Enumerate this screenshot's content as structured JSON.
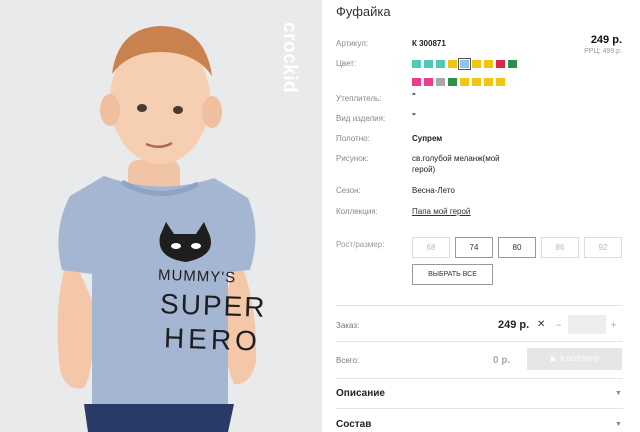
{
  "product": {
    "title": "Фуфайка",
    "price": "249 р.",
    "rrc": "РРЦ: 499 р.",
    "image": {
      "print_line1": "MUMMY'S",
      "print_line2": "SUPER",
      "print_line3": "HERO",
      "brand_logo_text": "crockid"
    }
  },
  "attributes": {
    "article_label": "Артикул:",
    "article_value": "К 300871",
    "color_label": "Цвет:",
    "insulation_label": "Утеплитель:",
    "insulation_value": "\"",
    "kind_label": "Вид изделия:",
    "kind_value": "\"",
    "fabric_label": "Полотно:",
    "fabric_value": "Супрем",
    "pattern_label": "Рисунок:",
    "pattern_value_l1": "св.голубой меланж(мой",
    "pattern_value_l2": "герой)",
    "season_label": "Сезон:",
    "season_value": "Весна-Лето",
    "collection_label": "Коллекция:",
    "collection_value": "Папа мой герой"
  },
  "swatches": [
    {
      "color": "#4fc9b8"
    },
    {
      "color": "#4fc9b8"
    },
    {
      "color": "#4fc9b8"
    },
    {
      "color": "#f2c515"
    },
    {
      "color": "#8ec3ea",
      "selected": true
    },
    {
      "color": "#f2c515"
    },
    {
      "color": "#f2c515"
    },
    {
      "color": "#d9264a"
    },
    {
      "color": "#2b8f4e"
    },
    {
      "color": "#e83e8c"
    },
    {
      "color": "#e83e8c"
    },
    {
      "color": "#a8a8a8"
    },
    {
      "color": "#2b8f4e"
    },
    {
      "color": "#f2c515"
    },
    {
      "color": "#f2c515"
    },
    {
      "color": "#f2c515"
    },
    {
      "color": "#f2c515"
    }
  ],
  "size": {
    "label": "Рост/размер:",
    "options": [
      {
        "label": "68",
        "available": false
      },
      {
        "label": "74",
        "available": true
      },
      {
        "label": "80",
        "available": true
      },
      {
        "label": "86",
        "available": false
      },
      {
        "label": "92",
        "available": false
      }
    ],
    "select_all": "ВЫБРАТЬ ВСЕ"
  },
  "order": {
    "label": "Заказ:",
    "price": "249 р.",
    "remove_symbol": "✕",
    "minus": "−",
    "plus": "+",
    "quantity": ""
  },
  "total": {
    "label": "Всего:",
    "value": "0 р.",
    "cart_button": "В КОРЗИНУ"
  },
  "accordion": {
    "description": "Описание",
    "composition": "Состав"
  }
}
